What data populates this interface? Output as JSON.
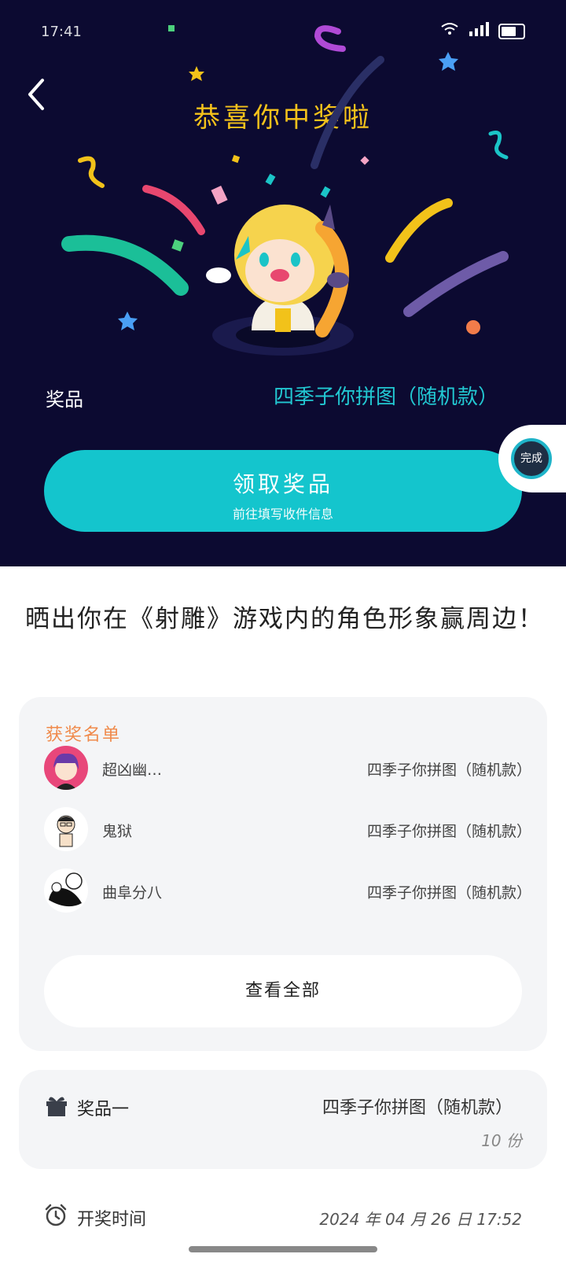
{
  "status_bar": {
    "time": "17:41"
  },
  "header": {
    "title": "恭喜你中奖啦",
    "prize_label": "奖品",
    "prize_value": "四季子你拼图（随机款）",
    "claim_button": {
      "label": "领取奖品",
      "sublabel": "前往填写收件信息"
    },
    "float_badge_text": "完成"
  },
  "headline": "晒出你在《射雕》游戏内的角色形象赢周边！",
  "winners": {
    "title": "获奖名单",
    "items": [
      {
        "name": "超凶幽…",
        "prize": "四季子你拼图（随机款）"
      },
      {
        "name": "鬼狱",
        "prize": "四季子你拼图（随机款）"
      },
      {
        "name": "曲阜分八",
        "prize": "四季子你拼图（随机款）"
      }
    ],
    "view_all": "查看全部"
  },
  "prize_info": {
    "label": "奖品一",
    "name": "四季子你拼图（随机款）",
    "quantity": "10 份"
  },
  "draw_time": {
    "label": "开奖时间",
    "value": "2024 年 04 月 26 日 17:52"
  },
  "colors": {
    "header_bg": "#0c0a31",
    "accent_teal": "#14c5cd",
    "title_gold": "#f5c21b",
    "winners_title": "#f08a4b"
  }
}
